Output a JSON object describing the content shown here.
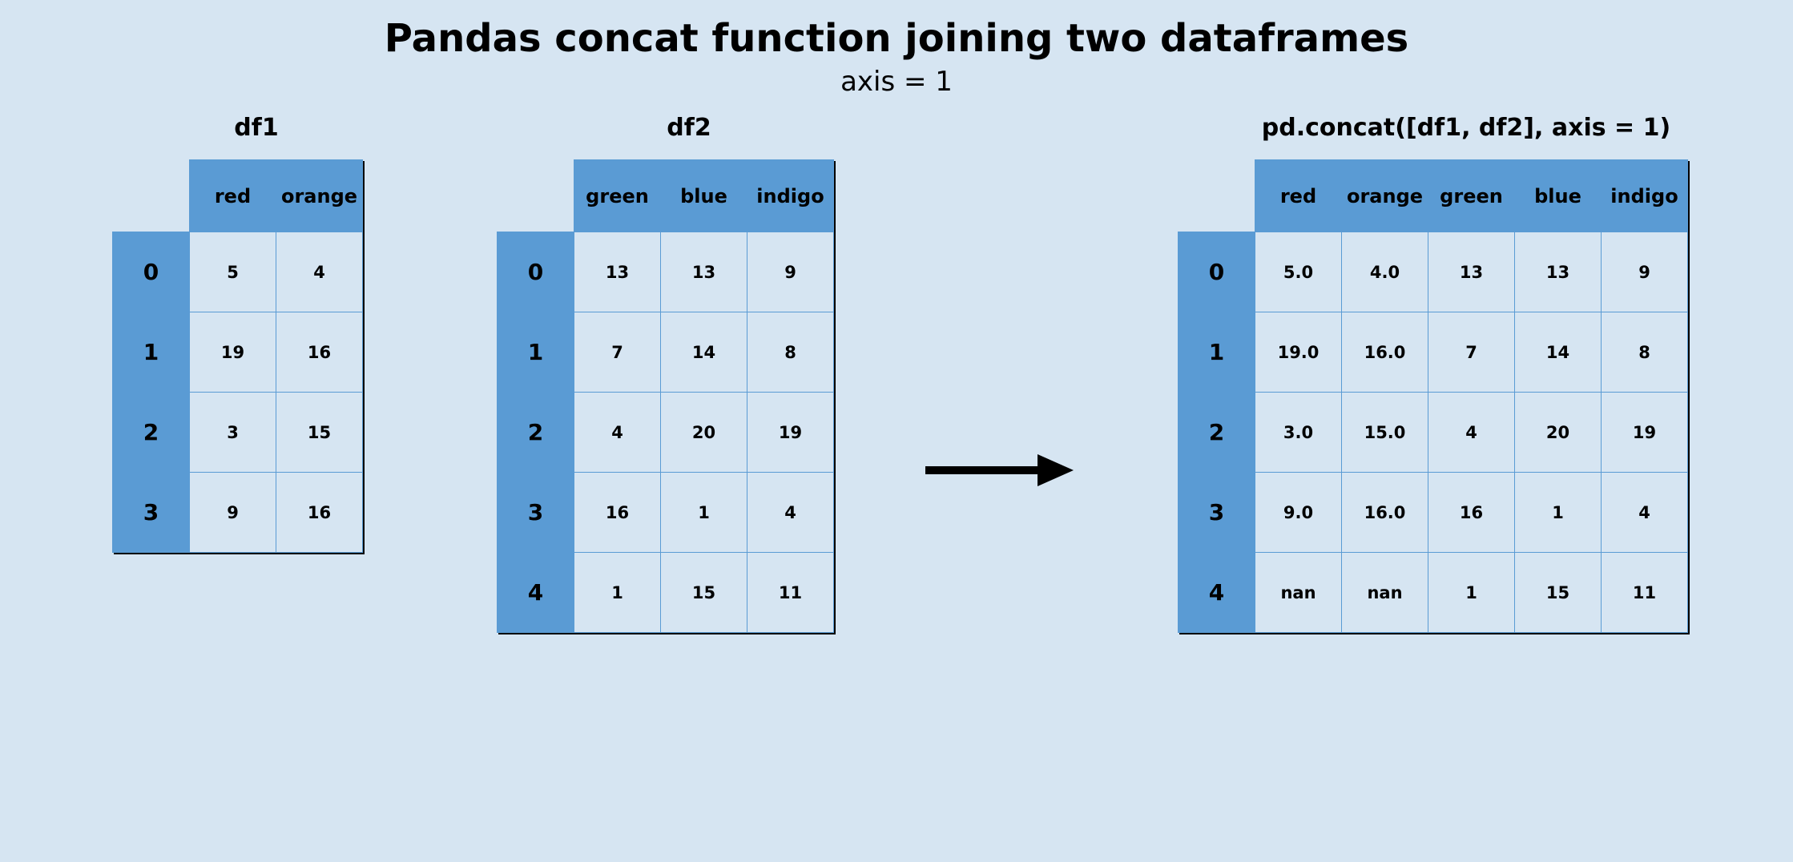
{
  "title": "Pandas concat function joining two dataframes",
  "subtitle": "axis = 1",
  "panels": {
    "df1": {
      "label": "df1",
      "columns": [
        "red",
        "orange"
      ],
      "index": [
        "0",
        "1",
        "2",
        "3"
      ],
      "data": [
        [
          "5",
          "4"
        ],
        [
          "19",
          "16"
        ],
        [
          "3",
          "15"
        ],
        [
          "9",
          "16"
        ]
      ]
    },
    "df2": {
      "label": "df2",
      "columns": [
        "green",
        "blue",
        "indigo"
      ],
      "index": [
        "0",
        "1",
        "2",
        "3",
        "4"
      ],
      "data": [
        [
          "13",
          "13",
          "9"
        ],
        [
          "7",
          "14",
          "8"
        ],
        [
          "4",
          "20",
          "19"
        ],
        [
          "16",
          "1",
          "4"
        ],
        [
          "1",
          "15",
          "11"
        ]
      ]
    },
    "result": {
      "label": "pd.concat([df1, df2], axis = 1)",
      "columns": [
        "red",
        "orange",
        "green",
        "blue",
        "indigo"
      ],
      "index": [
        "0",
        "1",
        "2",
        "3",
        "4"
      ],
      "data": [
        [
          "5.0",
          "4.0",
          "13",
          "13",
          "9"
        ],
        [
          "19.0",
          "16.0",
          "7",
          "14",
          "8"
        ],
        [
          "3.0",
          "15.0",
          "4",
          "20",
          "19"
        ],
        [
          "9.0",
          "16.0",
          "16",
          "1",
          "4"
        ],
        [
          "nan",
          "nan",
          "1",
          "15",
          "11"
        ]
      ]
    }
  },
  "chart_data": {
    "type": "table",
    "title": "Pandas concat function joining two dataframes",
    "subtitle": "axis = 1",
    "tables": [
      {
        "name": "df1",
        "columns": [
          "red",
          "orange"
        ],
        "index": [
          0,
          1,
          2,
          3
        ],
        "values": [
          [
            5,
            4
          ],
          [
            19,
            16
          ],
          [
            3,
            15
          ],
          [
            9,
            16
          ]
        ]
      },
      {
        "name": "df2",
        "columns": [
          "green",
          "blue",
          "indigo"
        ],
        "index": [
          0,
          1,
          2,
          3,
          4
        ],
        "values": [
          [
            13,
            13,
            9
          ],
          [
            7,
            14,
            8
          ],
          [
            4,
            20,
            19
          ],
          [
            16,
            1,
            4
          ],
          [
            1,
            15,
            11
          ]
        ]
      },
      {
        "name": "pd.concat([df1, df2], axis = 1)",
        "columns": [
          "red",
          "orange",
          "green",
          "blue",
          "indigo"
        ],
        "index": [
          0,
          1,
          2,
          3,
          4
        ],
        "values": [
          [
            5.0,
            4.0,
            13,
            13,
            9
          ],
          [
            19.0,
            16.0,
            7,
            14,
            8
          ],
          [
            3.0,
            15.0,
            4,
            20,
            19
          ],
          [
            9.0,
            16.0,
            16,
            1,
            4
          ],
          [
            "nan",
            "nan",
            1,
            15,
            11
          ]
        ]
      }
    ]
  }
}
